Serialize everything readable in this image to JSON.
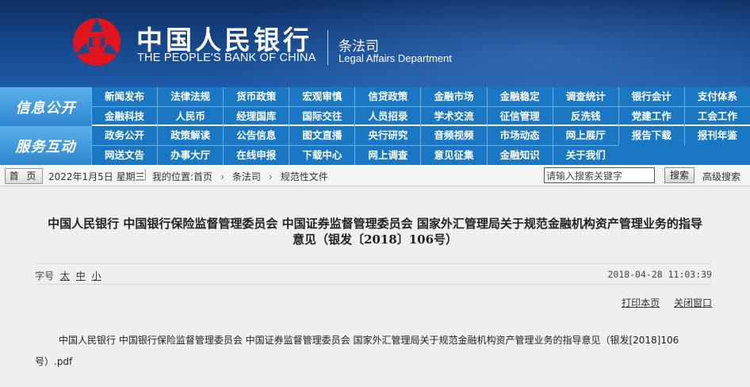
{
  "header": {
    "bank_cn": "中国人民银行",
    "bank_en": "THE PEOPLE'S BANK OF CHINA",
    "dept_cn": "条法司",
    "dept_en": "Legal Affairs Department",
    "logo_icon": "pboc-logo-icon",
    "colors": {
      "banner": "#17498e",
      "nav": "#1a77c4",
      "logo_red": "#e0141c"
    }
  },
  "nav": {
    "row1_label": "信息公开",
    "row1_items": [
      "新闻发布",
      "法律法规",
      "货币政策",
      "宏观审慎",
      "信贷政策",
      "金融市场",
      "金融稳定",
      "调查统计",
      "银行会计",
      "支付体系",
      "金融科技",
      "人民币",
      "经理国库",
      "国际交往",
      "人员招录",
      "学术交流",
      "征信管理",
      "反洗钱",
      "党建工作",
      "工会工作"
    ],
    "row2_label": "服务互动",
    "row2_items": [
      "政务公开",
      "政策解读",
      "公告信息",
      "图文直播",
      "央行研究",
      "音频视频",
      "市场动态",
      "网上展厅",
      "报告下载",
      "报刊年鉴",
      "网送文告",
      "办事大厅",
      "在线申报",
      "下载中心",
      "网上调查",
      "意见征集",
      "金融知识",
      "关于我们"
    ]
  },
  "infobar": {
    "home": "首 页",
    "date": "2022年1月5日 星期三",
    "location_label": "我的位置:",
    "crumbs": [
      "首页",
      "条法司",
      "规范性文件"
    ],
    "search_placeholder": "请输入搜索关键字",
    "search_button": "搜索",
    "advanced_search": "高级搜索"
  },
  "article": {
    "title_line1": "中国人民银行  中国银行保险监督管理委员会  中国证券监督管理委员会  国家外汇管理局关于规范金融机构资产管理业务的指导",
    "title_line2": "意见（银发〔2018〕106号）",
    "font_label": "字号",
    "font_sizes": [
      "太",
      "中",
      "小"
    ],
    "timestamp": "2018-04-28 11:03:39",
    "print": "打印本页",
    "close": "关闭窗口",
    "body_line1": "中国人民银行 中国银行保险监督管理委员会 中国证券监督管理委员会 国家外汇管理局关于规范金融机构资产管理业务的指导意见（银发[2018]106",
    "body_line2": "号）.pdf"
  }
}
